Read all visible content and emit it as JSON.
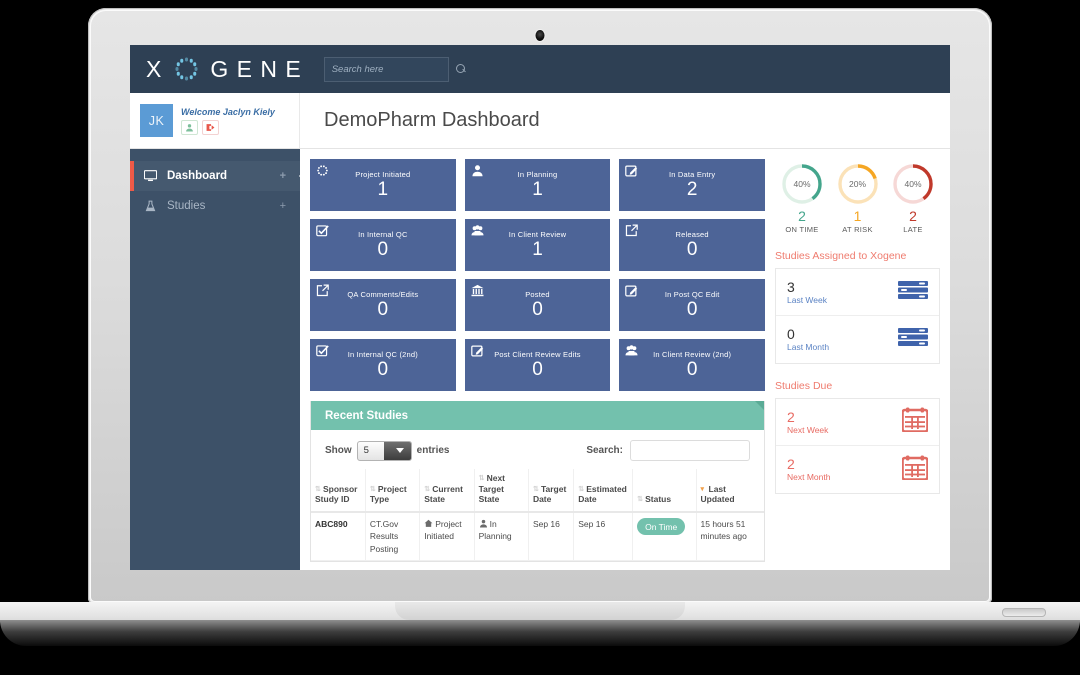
{
  "brand": {
    "logo_left": "X",
    "logo_right": "G E N E",
    "logo_o_icon": "dotted-circle-icon",
    "accent_blue": "#5b9bd5",
    "navbar_bg": "#2e4054",
    "sidebar_bg": "#3d5168",
    "card_bg": "#4d6497",
    "teal": "#73c1ad",
    "red": "#ef5a47",
    "salmon": "#ef7b6e"
  },
  "search": {
    "placeholder": "Search here",
    "value": ""
  },
  "user": {
    "initials": "JK",
    "welcome": "Welcome Jaclyn Kiely",
    "profile_icon": "user-icon",
    "logout_icon": "logout-icon"
  },
  "header": {
    "title": "DemoPharm Dashboard"
  },
  "sidebar": {
    "items": [
      {
        "label": "Dashboard",
        "icon": "monitor-icon",
        "active": true,
        "expand": "+"
      },
      {
        "label": "Studies",
        "icon": "flask-icon",
        "active": false,
        "expand": "+"
      }
    ]
  },
  "cards": [
    {
      "label": "Project Initiated",
      "value": "1",
      "icon": "dotted-circle-icon"
    },
    {
      "label": "In Planning",
      "value": "1",
      "icon": "user-icon"
    },
    {
      "label": "In Data Entry",
      "value": "2",
      "icon": "pencil-square-icon"
    },
    {
      "label": "In Internal QC",
      "value": "0",
      "icon": "check-square-icon"
    },
    {
      "label": "In Client Review",
      "value": "1",
      "icon": "users-icon"
    },
    {
      "label": "Released",
      "value": "0",
      "icon": "external-link-icon"
    },
    {
      "label": "QA Comments/Edits",
      "value": "0",
      "icon": "external-link-icon"
    },
    {
      "label": "Posted",
      "value": "0",
      "icon": "bank-icon"
    },
    {
      "label": "In Post QC Edit",
      "value": "0",
      "icon": "pencil-square-icon"
    },
    {
      "label": "In Internal QC (2nd)",
      "value": "0",
      "icon": "check-square-icon"
    },
    {
      "label": "Post Client Review Edits",
      "value": "0",
      "icon": "pencil-square-icon"
    },
    {
      "label": "In Client Review (2nd)",
      "value": "0",
      "icon": "users-icon"
    }
  ],
  "recent_studies": {
    "panel_title": "Recent Studies",
    "show_label": "Show",
    "entries_label": "entries",
    "page_size": "5",
    "search_label": "Search:",
    "search_value": "",
    "columns": [
      {
        "label": "Sponsor Study ID",
        "sort": "none"
      },
      {
        "label": "Project Type",
        "sort": "none"
      },
      {
        "label": "Current State",
        "sort": "none"
      },
      {
        "label": "Next Target State",
        "sort": "none"
      },
      {
        "label": "Target Date",
        "sort": "none"
      },
      {
        "label": "Estimated Date",
        "sort": "none"
      },
      {
        "label": "Status",
        "sort": "none"
      },
      {
        "label": "Last Updated",
        "sort": "desc"
      }
    ],
    "rows": [
      {
        "sponsor_study_id": "ABC890",
        "project_type": "CT.Gov Results Posting",
        "current_state": "Project Initiated",
        "current_state_icon": "home-icon",
        "next_target_state": "In Planning",
        "next_target_state_icon": "user-icon",
        "target_date": "Sep 16",
        "estimated_date": "Sep 16",
        "status": "On Time",
        "last_updated": "15 hours 51 minutes ago"
      }
    ]
  },
  "chart_data": [
    {
      "type": "pie",
      "title": "ON TIME",
      "percent": 40,
      "count": 2,
      "color": "#44a58c",
      "track_color": "#dff0e6"
    },
    {
      "type": "pie",
      "title": "AT RISK",
      "percent": 20,
      "count": 1,
      "color": "#f5a623",
      "track_color": "#fbe2b8"
    },
    {
      "type": "pie",
      "title": "LATE",
      "percent": 40,
      "count": 2,
      "color": "#c0392b",
      "track_color": "#f6d8d6"
    }
  ],
  "right_panels": [
    {
      "title": "Studies Assigned to Xogene",
      "style": "blue",
      "icon": "server-list-icon",
      "rows": [
        {
          "value": "3",
          "label": "Last Week"
        },
        {
          "value": "0",
          "label": "Last Month"
        }
      ]
    },
    {
      "title": "Studies Due",
      "style": "red",
      "icon": "calendar-icon",
      "rows": [
        {
          "value": "2",
          "label": "Next Week"
        },
        {
          "value": "2",
          "label": "Next Month"
        }
      ]
    }
  ]
}
